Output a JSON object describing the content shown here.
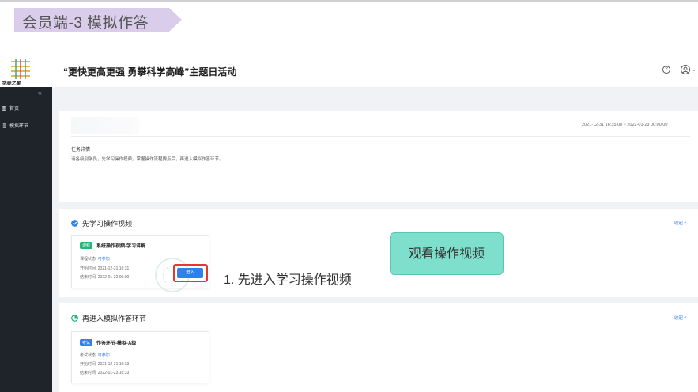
{
  "banner": {
    "text": "会员端-3  模拟作答",
    "color": "#d9cdeb"
  },
  "header": {
    "logo_text": "华辰之星",
    "title": "“更快更高更强 勇攀科学高峰”主题日活动",
    "help_icon": "help-circle-icon",
    "avatar_icon": "user-avatar-icon",
    "caret": "⌄"
  },
  "sidebar": {
    "collapse_label": "«",
    "items": [
      {
        "label": "首页",
        "icon": "grid-icon"
      },
      {
        "label": "模拟环节",
        "icon": "list-icon"
      }
    ]
  },
  "task": {
    "date_range": "2021-12-31 16:35:08 ~ 2022-01-23 00:00:00",
    "detail_label": "任务详情",
    "detail_text": "请各级别学员，先学习操作视频，掌握操作流程要点后，再进入模拟作答环节。"
  },
  "section1": {
    "title": "先学习操作视频",
    "collapse": "收起 ^",
    "item": {
      "tag": "课程",
      "name": "系统操作视频-学习讲解",
      "status_label": "课程状态: ",
      "status_value": "可参加",
      "start": "开始时间: 2021-12-31 16:31",
      "end": "结束时间: 2022-01-22 00:00",
      "button": "进入"
    }
  },
  "section2": {
    "title": "再进入模拟作答环节",
    "collapse": "收起 ^",
    "item": {
      "tag": "考试",
      "name": "作答环节-模拟-A级",
      "status_label": "考试状态: ",
      "status_value": "可参加",
      "start": "开始时间: 2021-12-31 16:33",
      "end": "结束时间: 2022-01-23 16:33"
    }
  },
  "annotations": {
    "step": "1. 先进入学习操作视频",
    "bubble": "观看操作视频"
  },
  "colors": {
    "accent": "#2f80ed",
    "sidebar_bg": "#1f232a",
    "section1_dot": "#2f80ed",
    "section2_dot": "#27b37a",
    "tag_course": "#27b37a",
    "tag_exam": "#2f80ed",
    "highlight": "#e03a2f",
    "bubble": "#7ee0cc"
  }
}
